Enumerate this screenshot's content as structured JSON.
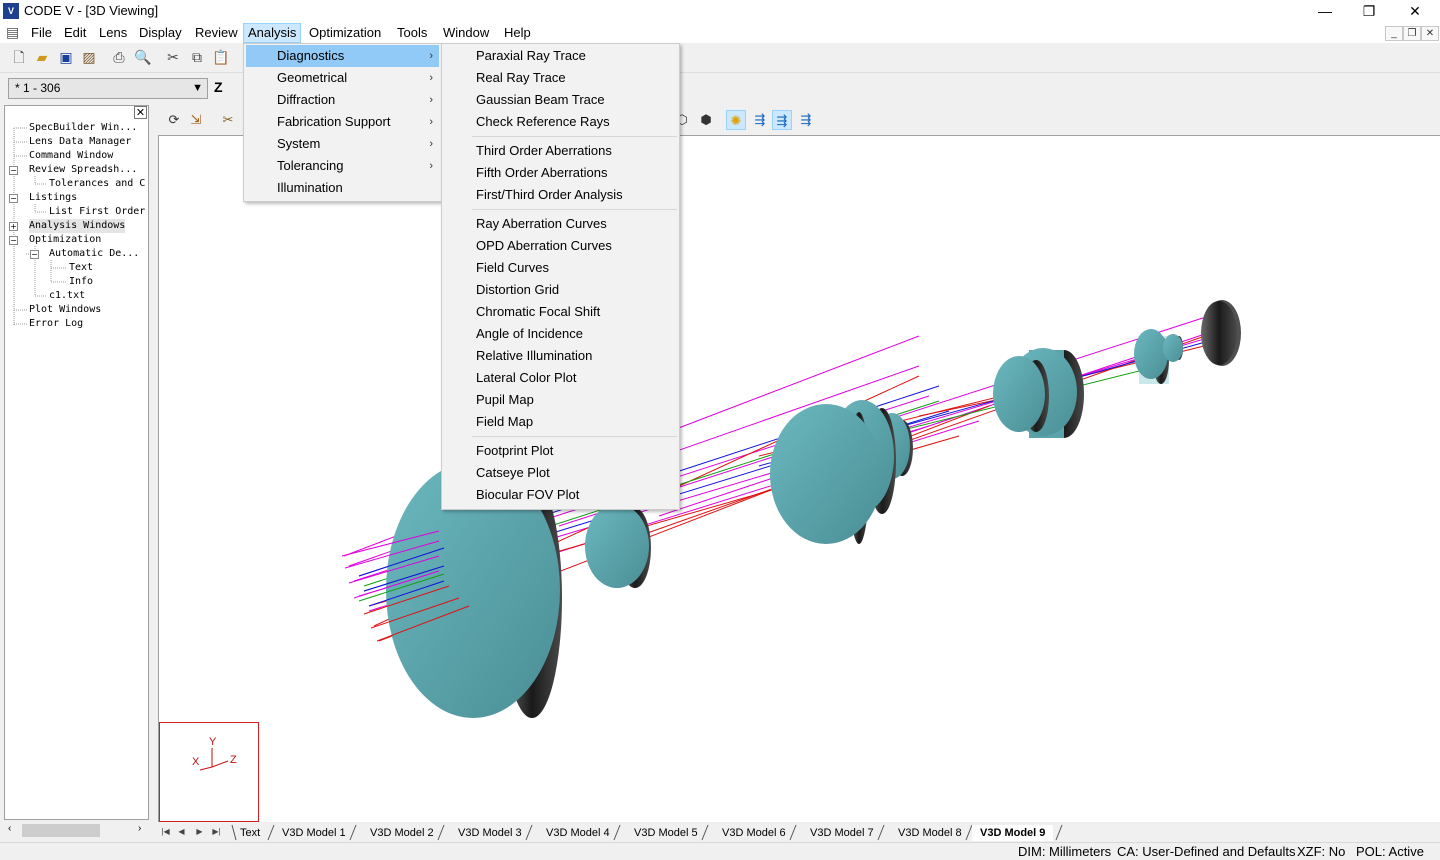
{
  "title_bar": {
    "app_icon": "CODE V",
    "title": "CODE V - [3D Viewing]",
    "minimize": "—",
    "restore": "❐",
    "close": "✕"
  },
  "menubar": {
    "items": [
      "File",
      "Edit",
      "Lens",
      "Display",
      "Review",
      "Analysis",
      "Optimization",
      "Tools",
      "Window",
      "Help"
    ],
    "active": "Analysis"
  },
  "toolbar": {
    "range_value": "* 1 - 306",
    "z_label": "Z"
  },
  "tree": {
    "items": [
      {
        "label": "SpecBuilder Win..."
      },
      {
        "label": "Lens Data Manager"
      },
      {
        "label": "Command Window"
      },
      {
        "label": "Review Spreadsh..."
      },
      {
        "label": "Tolerances and C"
      },
      {
        "label": "Listings"
      },
      {
        "label": "List First Order"
      },
      {
        "label": "Analysis Windows"
      },
      {
        "label": "Optimization"
      },
      {
        "label": "Automatic De..."
      },
      {
        "label": "Text"
      },
      {
        "label": "Info"
      },
      {
        "label": "c1.txt"
      },
      {
        "label": "Plot Windows"
      },
      {
        "label": "Error Log"
      }
    ]
  },
  "analysis_menu": {
    "items": [
      {
        "label": "Diagnostics",
        "submenu": true
      },
      {
        "label": "Geometrical",
        "submenu": true
      },
      {
        "label": "Diffraction",
        "submenu": true
      },
      {
        "label": "Fabrication Support",
        "submenu": true
      },
      {
        "label": "System",
        "submenu": true
      },
      {
        "label": "Tolerancing",
        "submenu": true
      },
      {
        "label": "Illumination",
        "submenu": false
      }
    ],
    "highlighted": "Diagnostics"
  },
  "diagnostics_menu": {
    "groups": [
      [
        "Paraxial Ray Trace",
        "Real Ray Trace",
        "Gaussian Beam Trace",
        "Check Reference Rays"
      ],
      [
        "Third Order Aberrations",
        "Fifth Order Aberrations",
        "First/Third Order Analysis"
      ],
      [
        "Ray Aberration Curves",
        "OPD Aberration Curves",
        "Field Curves",
        "Distortion Grid",
        "Chromatic Focal Shift",
        "Angle of Incidence",
        "Relative Illumination",
        "Lateral Color Plot",
        "Pupil Map",
        "Field Map"
      ],
      [
        "Footprint Plot",
        "Catseye Plot",
        "Biocular FOV Plot"
      ]
    ]
  },
  "axis_triad": {
    "x": "X",
    "y": "Y",
    "z": "Z"
  },
  "tabs": {
    "items": [
      "Text",
      "V3D Model 1",
      "V3D Model 2",
      "V3D Model 3",
      "V3D Model 4",
      "V3D Model 5",
      "V3D Model 6",
      "V3D Model 7",
      "V3D Model 8",
      "V3D Model 9"
    ],
    "active": "V3D Model 9"
  },
  "status": {
    "dim": "DIM: Millimeters",
    "ca": "CA: User-Defined and Defaults",
    "xzf": "XZF: No",
    "pol": "POL: Active"
  },
  "colors": {
    "lens_face": "#5aa3aa",
    "lens_edge": "#3a3a3a",
    "menu_highlight": "#91c9f7",
    "ray_magenta": "#e000e0",
    "ray_red": "#e01010",
    "ray_blue": "#1010e0",
    "ray_green": "#10a010"
  }
}
